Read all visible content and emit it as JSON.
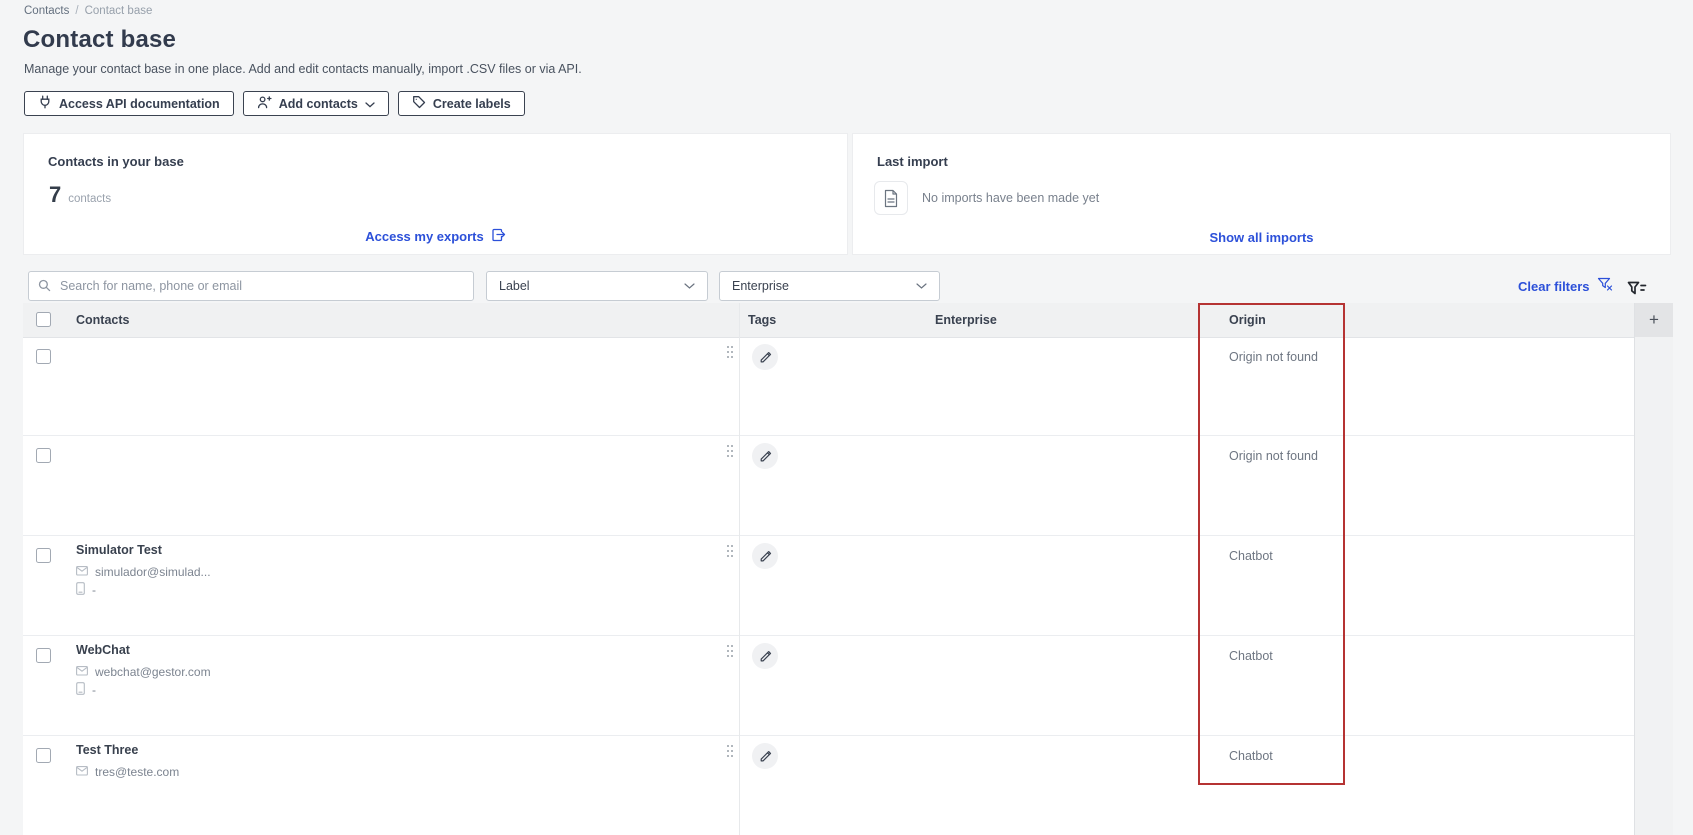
{
  "breadcrumb": {
    "home": "Contacts",
    "separator": "/",
    "current": "Contact base"
  },
  "page": {
    "title": "Contact base",
    "subtitle": "Manage your contact base in one place. Add and edit contacts manually, import .CSV files or via API."
  },
  "toolbar": {
    "api_button": "Access API documentation",
    "add_contacts_button": "Add contacts",
    "create_labels_button": "Create labels"
  },
  "cards": {
    "base": {
      "title": "Contacts in your base",
      "count": "7",
      "count_unit": "contacts",
      "exports_link": "Access my exports"
    },
    "import": {
      "title": "Last import",
      "empty_message": "No imports have been made yet",
      "link": "Show all imports"
    }
  },
  "filters": {
    "search_placeholder": "Search for name, phone or email",
    "label_dropdown": "Label",
    "enterprise_dropdown": "Enterprise",
    "clear_filters": "Clear filters"
  },
  "table": {
    "headers": {
      "contacts": "Contacts",
      "tags": "Tags",
      "enterprise": "Enterprise",
      "origin": "Origin",
      "add_column": "+"
    },
    "rows": [
      {
        "origin": "Origin not found"
      },
      {
        "origin": "Origin not found"
      },
      {
        "name": "Simulator Test",
        "email": "simulador@simulad...",
        "phone": "-",
        "origin": "Chatbot"
      },
      {
        "name": "WebChat",
        "email": "webchat@gestor.com",
        "phone": "-",
        "origin": "Chatbot"
      },
      {
        "name": "Test Three",
        "email": "tres@teste.com",
        "origin": "Chatbot"
      }
    ]
  },
  "annotation": {
    "highlighted_column": "Origin",
    "highlight_color": "#b53333"
  },
  "colors": {
    "accent_blue": "#2c50d9",
    "dark_text": "#353e4f",
    "page_background": "#f4f5f6"
  }
}
